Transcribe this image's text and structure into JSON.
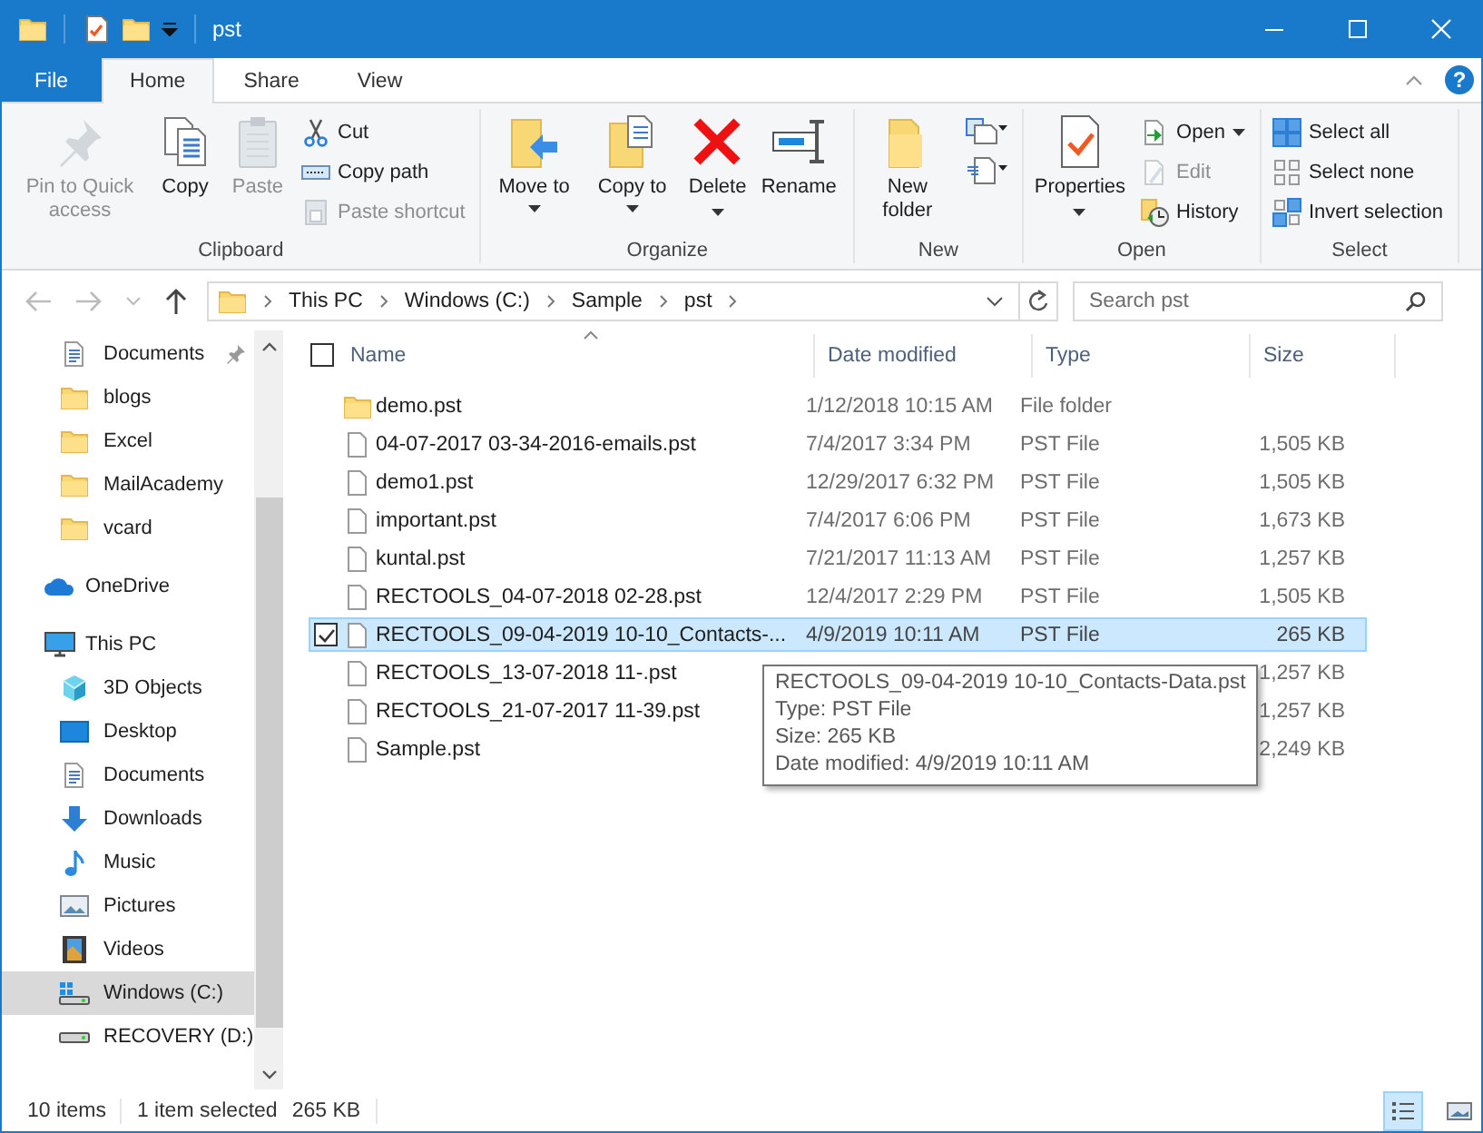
{
  "window": {
    "title": "pst"
  },
  "ribbon_tabs": [
    {
      "label": "File",
      "kind": "file",
      "selected": false
    },
    {
      "label": "Home",
      "kind": "tab",
      "selected": true
    },
    {
      "label": "Share",
      "kind": "tab",
      "selected": false
    },
    {
      "label": "View",
      "kind": "tab",
      "selected": false
    }
  ],
  "help": "?",
  "ribbon_groups": [
    {
      "label": "Clipboard",
      "large": [
        {
          "label": "Pin to Quick access",
          "kind": "plain",
          "disabled": true
        },
        {
          "label": "Copy",
          "kind": "plain",
          "disabled": false
        },
        {
          "label": "Paste",
          "kind": "plain",
          "disabled": true
        }
      ],
      "small": [
        {
          "label": "Cut",
          "kind": "plain",
          "disabled": false
        },
        {
          "label": "Copy path",
          "kind": "plain",
          "disabled": false
        },
        {
          "label": "Paste shortcut",
          "kind": "plain",
          "disabled": true
        }
      ]
    },
    {
      "label": "Organize",
      "large": [
        {
          "label": "Move to",
          "kind": "menu",
          "disabled": false
        },
        {
          "label": "Copy to",
          "kind": "menu",
          "disabled": false
        },
        {
          "label": "Delete",
          "kind": "split",
          "disabled": false
        },
        {
          "label": "Rename",
          "kind": "plain",
          "disabled": false
        }
      ]
    },
    {
      "label": "New",
      "large": [
        {
          "label": "New folder",
          "kind": "plain",
          "disabled": false
        }
      ],
      "small": [
        {
          "kind": "menu",
          "disabled": false
        },
        {
          "kind": "menu",
          "disabled": false
        }
      ]
    },
    {
      "label": "Open",
      "large": [
        {
          "label": "Properties",
          "kind": "split",
          "disabled": false
        }
      ],
      "small": [
        {
          "label": "Open",
          "kind": "menu",
          "disabled": false
        },
        {
          "label": "Edit",
          "kind": "plain",
          "disabled": true
        },
        {
          "label": "History",
          "kind": "plain",
          "disabled": false
        }
      ]
    },
    {
      "label": "Select",
      "small": [
        {
          "label": "Select all",
          "kind": "plain",
          "disabled": false
        },
        {
          "label": "Select none",
          "kind": "plain",
          "disabled": false
        },
        {
          "label": "Invert selection",
          "kind": "plain",
          "disabled": false
        }
      ]
    }
  ],
  "address": {
    "breadcrumbs": [
      "This PC",
      "Windows (C:)",
      "Sample",
      "pst"
    ]
  },
  "search": {
    "placeholder": "Search pst"
  },
  "nav": {
    "quick_access": [
      {
        "label": "Documents",
        "kind": "documents",
        "pinned": true,
        "selected": false
      },
      {
        "label": "blogs",
        "kind": "folder",
        "pinned": false,
        "selected": false
      },
      {
        "label": "Excel",
        "kind": "folder",
        "pinned": false,
        "selected": false
      },
      {
        "label": "MailAcademy",
        "kind": "folder",
        "pinned": false,
        "selected": false
      },
      {
        "label": "vcard",
        "kind": "folder",
        "pinned": false,
        "selected": false
      }
    ],
    "tree": [
      {
        "label": "OneDrive",
        "kind": "onedrive",
        "selected": false
      },
      {
        "label": "This PC",
        "kind": "pc",
        "selected": false,
        "children": [
          {
            "label": "3D Objects",
            "kind": "objects3d",
            "selected": false
          },
          {
            "label": "Desktop",
            "kind": "desktop",
            "selected": false
          },
          {
            "label": "Documents",
            "kind": "documents",
            "selected": false
          },
          {
            "label": "Downloads",
            "kind": "downloads",
            "selected": false
          },
          {
            "label": "Music",
            "kind": "music",
            "selected": false
          },
          {
            "label": "Pictures",
            "kind": "pictures",
            "selected": false
          },
          {
            "label": "Videos",
            "kind": "videos",
            "selected": false
          },
          {
            "label": "Windows (C:)",
            "kind": "drive-win",
            "selected": true
          },
          {
            "label": "RECOVERY (D:)",
            "kind": "drive",
            "selected": false
          }
        ]
      }
    ]
  },
  "files": {
    "select_all": {
      "checked": false
    },
    "columns": [
      {
        "label": "Name",
        "sorted": true
      },
      {
        "label": "Date modified",
        "sorted": false
      },
      {
        "label": "Type",
        "sorted": false
      },
      {
        "label": "Size",
        "sorted": false
      }
    ],
    "rows": [
      {
        "name": "demo.pst",
        "date": "1/12/2018 10:15 AM",
        "type": "File folder",
        "kind": "folder",
        "selected": false
      },
      {
        "name": "04-07-2017 03-34-2016-emails.pst",
        "date": "7/4/2017 3:34 PM",
        "type": "PST File",
        "size": "1,505 KB",
        "kind": "file",
        "selected": false
      },
      {
        "name": "demo1.pst",
        "date": "12/29/2017 6:32 PM",
        "type": "PST File",
        "size": "1,505 KB",
        "kind": "file",
        "selected": false
      },
      {
        "name": "important.pst",
        "date": "7/4/2017 6:06 PM",
        "type": "PST File",
        "size": "1,673 KB",
        "kind": "file",
        "selected": false
      },
      {
        "name": "kuntal.pst",
        "date": "7/21/2017 11:13 AM",
        "type": "PST File",
        "size": "1,257 KB",
        "kind": "file",
        "selected": false
      },
      {
        "name": "RECTOOLS_04-07-2018 02-28.pst",
        "date": "12/4/2017 2:29 PM",
        "type": "PST File",
        "size": "1,505 KB",
        "kind": "file",
        "selected": false
      },
      {
        "name": "RECTOOLS_09-04-2019 10-10_Contacts-...",
        "date": "4/9/2019 10:11 AM",
        "type": "PST File",
        "size": "265 KB",
        "kind": "file",
        "selected": true
      },
      {
        "name": "RECTOOLS_13-07-2018 11-.pst",
        "size": "1,257 KB",
        "kind": "file",
        "selected": false
      },
      {
        "name": "RECTOOLS_21-07-2017 11-39.pst",
        "size": "1,257 KB",
        "kind": "file",
        "selected": false
      },
      {
        "name": "Sample.pst",
        "size": "2,249 KB",
        "kind": "file",
        "selected": false
      }
    ]
  },
  "tooltip": {
    "lines": [
      "RECTOOLS_09-04-2019 10-10_Contacts-Data.pst",
      "Type: PST File",
      "Size: 265 KB",
      "Date modified: 4/9/2019 10:11 AM"
    ]
  },
  "status_bar": {
    "item_count": "10 items",
    "selection": "1 item selected",
    "selection_size": "265 KB"
  },
  "views": [
    {
      "kind": "details",
      "selected": true
    },
    {
      "kind": "large-icons",
      "selected": false
    }
  ]
}
